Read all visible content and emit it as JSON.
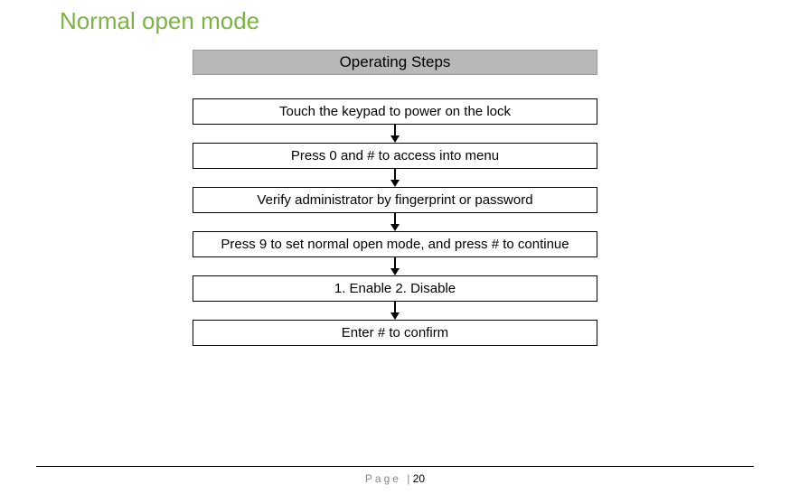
{
  "title": "Normal open mode",
  "header": "Operating Steps",
  "steps": [
    "Touch the keypad to power on the lock",
    "Press  0 and  # to access into menu",
    "Verify administrator by fingerprint or password",
    "Press 9 to set normal open mode, and press # to continue",
    "1. Enable  2. Disable",
    "Enter # to confirm"
  ],
  "footer": {
    "page_label": "Page ",
    "separator": "| ",
    "page_number": "20"
  }
}
